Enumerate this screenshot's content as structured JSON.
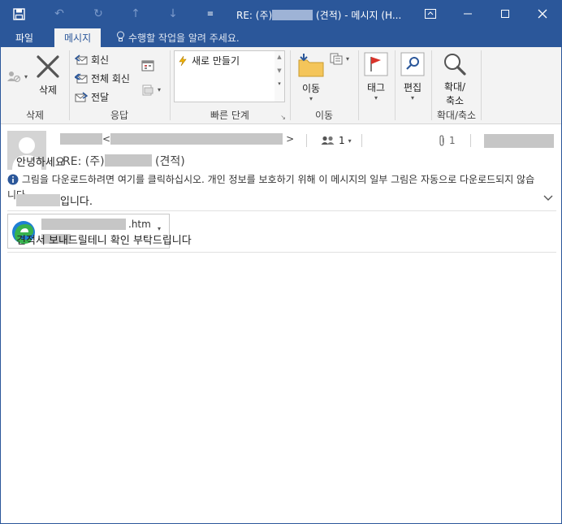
{
  "window": {
    "title_prefix": "RE: (주)",
    "title_suffix": " (견적) - 메시지 (H..."
  },
  "tabs": [
    {
      "label": "파일",
      "active": false
    },
    {
      "label": "메시지",
      "active": true
    }
  ],
  "tell_me": "수행할 작업을 알려 주세요.",
  "ribbon": {
    "delete": {
      "label": "삭제",
      "group": "삭제"
    },
    "respond": {
      "reply": "회신",
      "reply_all": "전체 회신",
      "forward": "전달",
      "group": "응답"
    },
    "quick_steps": {
      "item": "새로 만들기",
      "group": "빠른 단계"
    },
    "move": {
      "label": "이동",
      "group": "이동"
    },
    "tags": {
      "label": "태그"
    },
    "editing": {
      "label": "편집"
    },
    "zoom": {
      "label_1": "확대/",
      "label_2": "축소",
      "group": "확대/축소"
    }
  },
  "message": {
    "from_open": "<",
    "from_close": ">",
    "recipients_count": "1",
    "attachments_count": "1",
    "subject_prefix": "RE: (주)",
    "subject_suffix": " (견적)",
    "info_bar": "그림을 다운로드하려면 여기를 클릭하십시오. 개인 정보를 보호하기 위해 이 메시지의 일부 그림은 자동으로 다운로드되지 않습니다.",
    "attachment_ext": ".htm",
    "body": {
      "greeting": "안녕하세요",
      "intro_suffix": "입니다.",
      "request": "견적서 보내드릴테니 확인 부탁드립니다"
    }
  },
  "colors": {
    "accent": "#2b579a",
    "ribbon_bg": "#f3f3f3",
    "redaction": "#c6c6c6"
  }
}
